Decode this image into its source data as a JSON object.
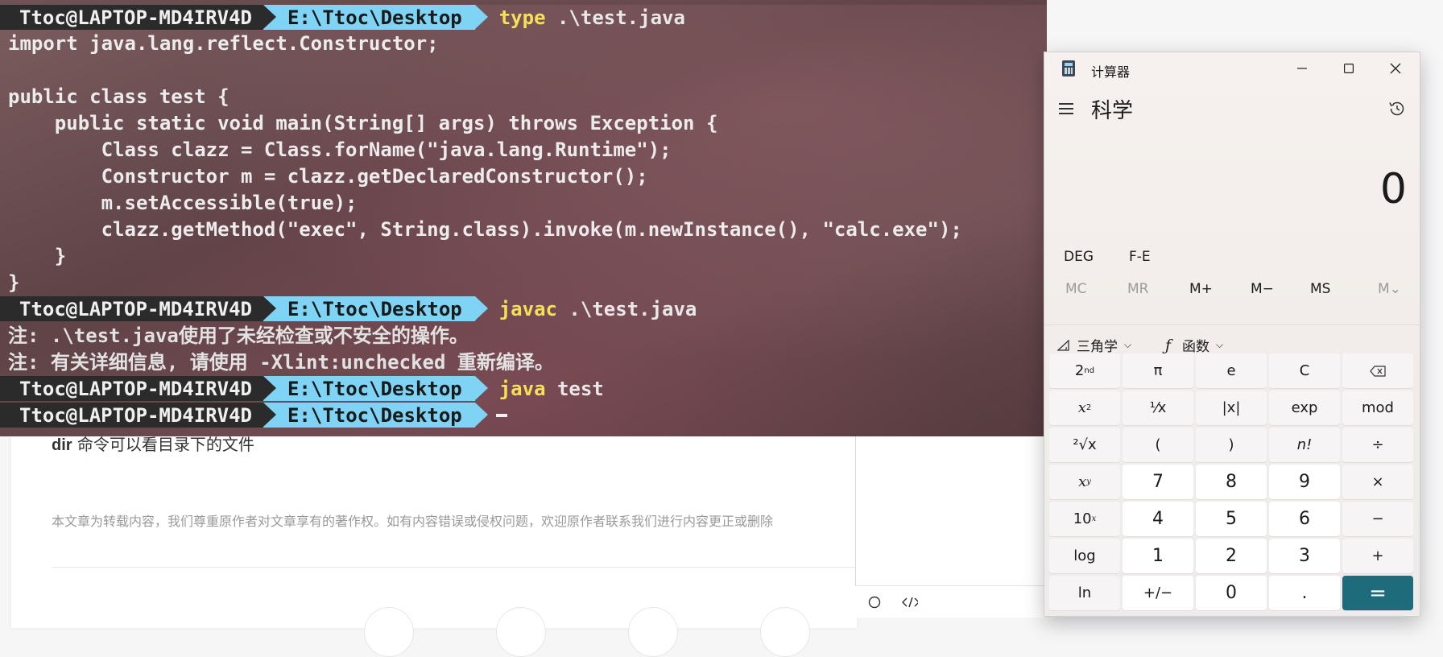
{
  "terminal": {
    "prompt_user": "Ttoc@LAPTOP-MD4IRV4D",
    "prompt_path": "E:\\Ttoc\\Desktop",
    "cmd1_kw": "type",
    "cmd1_arg": " .\\test.java",
    "code_lines": [
      "import java.lang.reflect.Constructor;",
      "",
      "public class test {",
      "    public static void main(String[] args) throws Exception {",
      "        Class clazz = Class.forName(\"java.lang.Runtime\");",
      "        Constructor m = clazz.getDeclaredConstructor();",
      "        m.setAccessible(true);",
      "        clazz.getMethod(\"exec\", String.class).invoke(m.newInstance(), \"calc.exe\");",
      "    }",
      "}"
    ],
    "cmd2_kw": "javac",
    "cmd2_arg": " .\\test.java",
    "note1": "注: .\\test.java使用了未经检查或不安全的操作。",
    "note2": "注: 有关详细信息, 请使用 -Xlint:unchecked 重新编译。",
    "cmd3_kw": "java",
    "cmd3_arg": " test"
  },
  "article": {
    "line_cmd": "dir",
    "line_text": " 命令可以看目录下的文件",
    "copyright": "本文章为转载内容，我们尊重原作者对文章享有的著作权。如有内容错误或侵权问题，欢迎原作者联系我们进行内容更正或删除"
  },
  "calculator": {
    "app_title": "计算器",
    "mode_title": "科学",
    "display_value": "0",
    "angle_mode": "DEG",
    "fe_label": "F-E",
    "memory": [
      "MC",
      "MR",
      "M+",
      "M−",
      "MS",
      "M⌄"
    ],
    "trig_label": "三角学",
    "func_label": "函数",
    "keys_row1": [
      "2nd",
      "π",
      "e",
      "C",
      "⌫"
    ],
    "keys_row2": [
      "x²",
      "¹⁄x",
      "|x|",
      "exp",
      "mod"
    ],
    "keys_row3": [
      "²√x",
      "(",
      ")",
      "n!",
      "÷"
    ],
    "keys_row4": [
      "xʸ",
      "7",
      "8",
      "9",
      "×"
    ],
    "keys_row5": [
      "10ˣ",
      "4",
      "5",
      "6",
      "−"
    ],
    "keys_row6": [
      "log",
      "1",
      "2",
      "3",
      "+"
    ],
    "keys_row7": [
      "ln",
      "+/−",
      "0",
      ".",
      "="
    ],
    "accent_color": "#1e6b7b"
  }
}
